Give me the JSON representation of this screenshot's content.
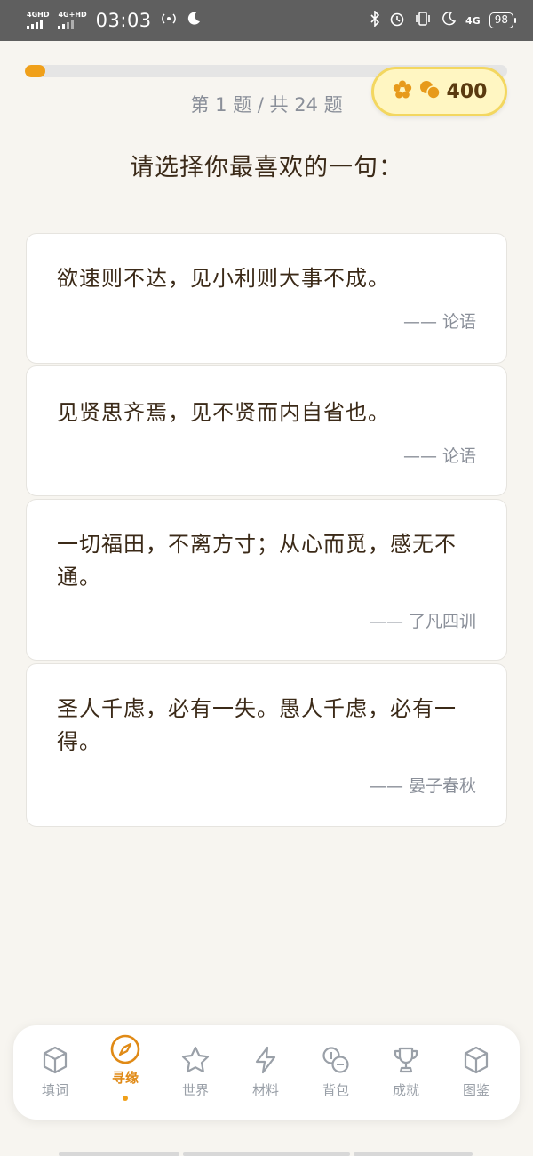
{
  "status_bar": {
    "sim1": "4GHD",
    "sim2": "4G+HD",
    "time": "03:03",
    "network_right": "4G",
    "battery": "98"
  },
  "quiz": {
    "progress_fraction": 0.042,
    "counter": "第 1 题 / 共 24 题",
    "coins": "400",
    "prompt": "请选择你最喜欢的一句："
  },
  "options": [
    {
      "quote": "欲速则不达，见小利则大事不成。",
      "source": "—— 论语"
    },
    {
      "quote": "见贤思齐焉，见不贤而内自省也。",
      "source": "—— 论语"
    },
    {
      "quote": "一切福田，不离方寸；从心而觅，感无不通。",
      "source": "—— 了凡四训"
    },
    {
      "quote": "圣人千虑，必有一失。愚人千虑，必有一得。",
      "source": "—— 晏子春秋"
    }
  ],
  "nav": {
    "items": [
      {
        "label": "填词",
        "icon": "cube-icon"
      },
      {
        "label": "寻缘",
        "icon": "compass-icon",
        "active": true
      },
      {
        "label": "世界",
        "icon": "star-icon"
      },
      {
        "label": "材料",
        "icon": "lightning-icon"
      },
      {
        "label": "背包",
        "icon": "coins-icon"
      },
      {
        "label": "成就",
        "icon": "trophy-icon"
      },
      {
        "label": "图鉴",
        "icon": "cube-icon"
      }
    ]
  },
  "colors": {
    "accent": "#f0a01a",
    "active_nav": "#e08a16",
    "text_primary": "#3b2a18",
    "text_secondary": "#8a8f99",
    "coin_bg": "#fff6c2",
    "coin_border": "#f3d760"
  }
}
